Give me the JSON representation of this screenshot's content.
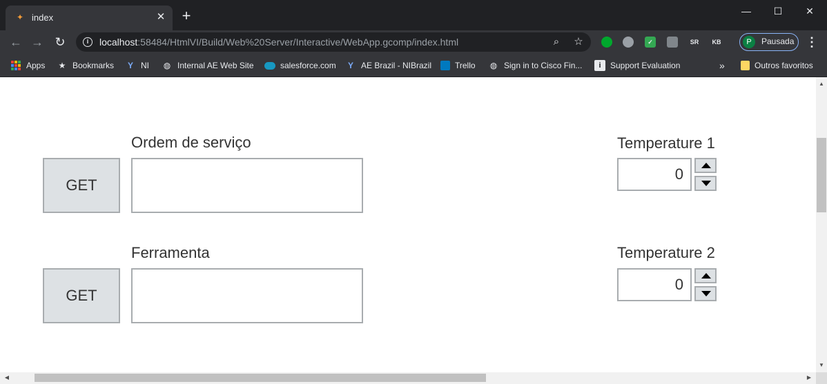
{
  "browser": {
    "tab": {
      "title": "index",
      "favicon": "labview-icon",
      "close": "✕"
    },
    "new_tab": "+",
    "window_controls": {
      "minimize": "—",
      "maximize": "☐",
      "close": "✕"
    },
    "url_host": "localhost",
    "url_rest": ":58484/HtmlVI/Build/Web%20Server/Interactive/WebApp.gcomp/index.html",
    "profile": {
      "initial": "P",
      "label": "Pausada"
    },
    "extensions": [
      "evernote-icon",
      "circle-extension-icon",
      "mail-check-icon",
      "cast-extension-icon",
      "sr-extension-icon",
      "kb-extension-icon"
    ]
  },
  "bookmarks": {
    "items": [
      {
        "label": "Apps",
        "icon": "apps-grid-icon"
      },
      {
        "label": "Bookmarks",
        "icon": "star-icon"
      },
      {
        "label": "NI",
        "icon": "ni-icon"
      },
      {
        "label": "Internal AE Web Site",
        "icon": "globe-icon"
      },
      {
        "label": "salesforce.com",
        "icon": "salesforce-cloud-icon"
      },
      {
        "label": "AE Brazil - NIBrazil",
        "icon": "ni-icon"
      },
      {
        "label": "Trello",
        "icon": "trello-icon"
      },
      {
        "label": "Sign in to Cisco Fin...",
        "icon": "globe-icon"
      },
      {
        "label": "Support Evaluation",
        "icon": "info-icon"
      }
    ],
    "overflow": "»",
    "other": {
      "label": "Outros favoritos",
      "icon": "folder-icon"
    }
  },
  "page": {
    "row1": {
      "label": "Ordem de serviço",
      "button": "GET",
      "value": ""
    },
    "row2": {
      "label": "Ferramenta",
      "button": "GET",
      "value": ""
    },
    "temp1": {
      "label": "Temperature 1",
      "value": "0"
    },
    "temp2": {
      "label": "Temperature 2",
      "value": "0"
    }
  },
  "colors": {
    "chrome_dark": "#202124",
    "chrome_mid": "#35363a",
    "control_fill": "#dde1e4",
    "control_border": "#a8acaf"
  }
}
